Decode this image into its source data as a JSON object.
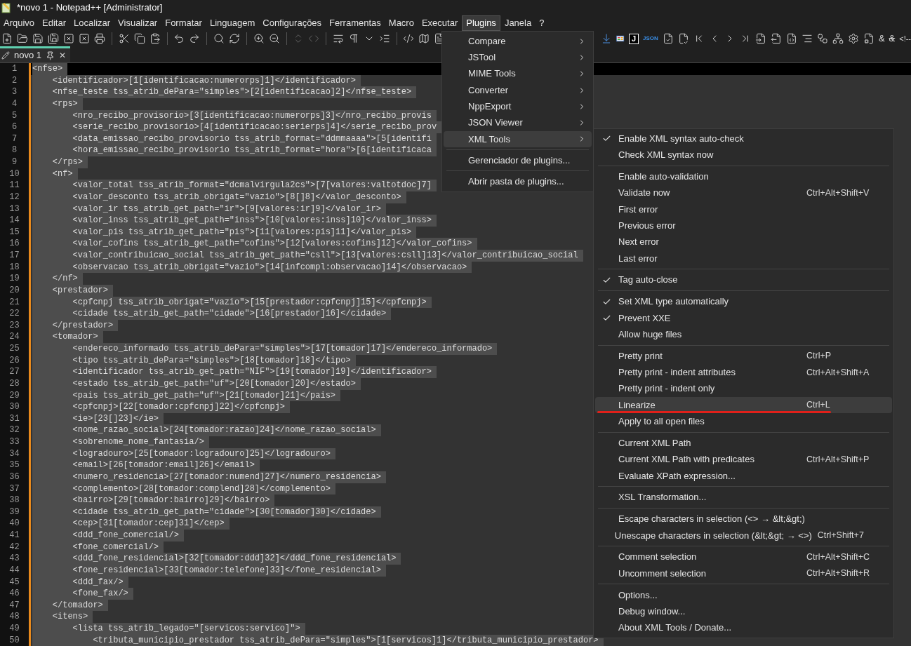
{
  "window": {
    "title": "*novo 1 - Notepad++ [Administrator]"
  },
  "menu_bar": [
    {
      "label": "Arquivo",
      "selected": false
    },
    {
      "label": "Editar",
      "selected": false
    },
    {
      "label": "Localizar",
      "selected": false
    },
    {
      "label": "Visualizar",
      "selected": false
    },
    {
      "label": "Formatar",
      "selected": false
    },
    {
      "label": "Linguagem",
      "selected": false
    },
    {
      "label": "Configurações",
      "selected": false
    },
    {
      "label": "Ferramentas",
      "selected": false
    },
    {
      "label": "Macro",
      "selected": false
    },
    {
      "label": "Executar",
      "selected": false
    },
    {
      "label": "Plugins",
      "selected": true
    },
    {
      "label": "Janela",
      "selected": false
    },
    {
      "label": "?",
      "selected": false
    }
  ],
  "toolbar": {
    "badges": [
      "J",
      "JSON"
    ],
    "glyphs": [
      "&",
      "&",
      "<!--"
    ]
  },
  "tabs": [
    {
      "label": "novo 1",
      "selected": true,
      "close": "✕"
    }
  ],
  "editor": {
    "lines": [
      {
        "n": "1",
        "text": "<nfse>",
        "selected": true,
        "current": true
      },
      {
        "n": "2",
        "text": "    <identificador>[1[identificacao:numerorps]1]</identificador>",
        "selected": true,
        "current": false
      },
      {
        "n": "3",
        "text": "    <nfse_teste tss_atrib_dePara=\"simples\">[2[identificacao]2]</nfse_teste>",
        "selected": true,
        "current": false
      },
      {
        "n": "4",
        "text": "    <rps>",
        "selected": true,
        "current": false
      },
      {
        "n": "5",
        "text": "        <nro_recibo_provisorio>[3[identificacao:numerorps]3]</nro_recibo_provis",
        "selected": true,
        "current": false
      },
      {
        "n": "6",
        "text": "        <serie_recibo_provisorio>[4[identificacao:serierps]4]</serie_recibo_prov",
        "selected": true,
        "current": false
      },
      {
        "n": "7",
        "text": "        <data_emissao_recibo_provisorio tss_atrib_format=\"ddmmaaaa\">[5[identifi",
        "selected": true,
        "current": false
      },
      {
        "n": "8",
        "text": "        <hora_emissao_recibo_provisorio tss_atrib_format=\"hora\">[6[identificaca",
        "selected": true,
        "current": false
      },
      {
        "n": "9",
        "text": "    </rps>",
        "selected": true,
        "current": false
      },
      {
        "n": "10",
        "text": "    <nf>",
        "selected": true,
        "current": false
      },
      {
        "n": "11",
        "text": "        <valor_total tss_atrib_format=\"dcmalvirgula2cs\">[7[valores:valtotdoc]7]",
        "selected": true,
        "current": false
      },
      {
        "n": "12",
        "text": "        <valor_desconto tss_atrib_obrigat=\"vazio\">[8[]8]</valor_desconto>",
        "selected": true,
        "current": false
      },
      {
        "n": "13",
        "text": "        <valor_ir tss_atrib_get_path=\"ir\">[9[valores:ir]9]</valor_ir>",
        "selected": true,
        "current": false
      },
      {
        "n": "14",
        "text": "        <valor_inss tss_atrib_get_path=\"inss\">[10[valores:inss]10]</valor_inss>",
        "selected": true,
        "current": false
      },
      {
        "n": "15",
        "text": "        <valor_pis tss_atrib_get_path=\"pis\">[11[valores:pis]11]</valor_pis>",
        "selected": true,
        "current": false
      },
      {
        "n": "16",
        "text": "        <valor_cofins tss_atrib_get_path=\"cofins\">[12[valores:cofins]12]</valor_cofins>",
        "selected": true,
        "current": false
      },
      {
        "n": "17",
        "text": "        <valor_contribuicao_social tss_atrib_get_path=\"csll\">[13[valores:csll]13]</valor_contribuicao_social",
        "selected": true,
        "current": false
      },
      {
        "n": "18",
        "text": "        <observacao tss_atrib_obrigat=\"vazio\">[14[infcompl:observacao]14]</observacao>",
        "selected": true,
        "current": false
      },
      {
        "n": "19",
        "text": "    </nf>",
        "selected": true,
        "current": false
      },
      {
        "n": "20",
        "text": "    <prestador>",
        "selected": true,
        "current": false
      },
      {
        "n": "21",
        "text": "        <cpfcnpj tss_atrib_obrigat=\"vazio\">[15[prestador:cpfcnpj]15]</cpfcnpj>",
        "selected": true,
        "current": false
      },
      {
        "n": "22",
        "text": "        <cidade tss_atrib_get_path=\"cidade\">[16[prestador]16]</cidade>",
        "selected": true,
        "current": false
      },
      {
        "n": "23",
        "text": "    </prestador>",
        "selected": true,
        "current": false
      },
      {
        "n": "24",
        "text": "    <tomador>",
        "selected": true,
        "current": false
      },
      {
        "n": "25",
        "text": "        <endereco_informado tss_atrib_dePara=\"simples\">[17[tomador]17]</endereco_informado>",
        "selected": true,
        "current": false
      },
      {
        "n": "26",
        "text": "        <tipo tss_atrib_dePara=\"simples\">[18[tomador]18]</tipo>",
        "selected": true,
        "current": false
      },
      {
        "n": "27",
        "text": "        <identificador tss_atrib_get_path=\"NIF\">[19[tomador]19]</identificador>",
        "selected": true,
        "current": false
      },
      {
        "n": "28",
        "text": "        <estado tss_atrib_get_path=\"uf\">[20[tomador]20]</estado>",
        "selected": true,
        "current": false
      },
      {
        "n": "29",
        "text": "        <pais tss_atrib_get_path=\"uf\">[21[tomador]21]</pais>",
        "selected": true,
        "current": false
      },
      {
        "n": "30",
        "text": "        <cpfcnpj>[22[tomador:cpfcnpj]22]</cpfcnpj>",
        "selected": true,
        "current": false
      },
      {
        "n": "31",
        "text": "        <ie>[23[]23]</ie>",
        "selected": true,
        "current": false
      },
      {
        "n": "32",
        "text": "        <nome_razao_social>[24[tomador:razao]24]</nome_razao_social>",
        "selected": true,
        "current": false
      },
      {
        "n": "33",
        "text": "        <sobrenome_nome_fantasia/>",
        "selected": true,
        "current": false
      },
      {
        "n": "34",
        "text": "        <logradouro>[25[tomador:logradouro]25]</logradouro>",
        "selected": true,
        "current": false
      },
      {
        "n": "35",
        "text": "        <email>[26[tomador:email]26]</email>",
        "selected": true,
        "current": false
      },
      {
        "n": "36",
        "text": "        <numero_residencia>[27[tomador:numend]27]</numero_residencia>",
        "selected": true,
        "current": false
      },
      {
        "n": "37",
        "text": "        <complemento>[28[tomador:complend]28]</complemento>",
        "selected": true,
        "current": false
      },
      {
        "n": "38",
        "text": "        <bairro>[29[tomador:bairro]29]</bairro>",
        "selected": true,
        "current": false
      },
      {
        "n": "39",
        "text": "        <cidade tss_atrib_get_path=\"cidade\">[30[tomador]30]</cidade>",
        "selected": true,
        "current": false
      },
      {
        "n": "40",
        "text": "        <cep>[31[tomador:cep]31]</cep>",
        "selected": true,
        "current": false
      },
      {
        "n": "41",
        "text": "        <ddd_fone_comercial/>",
        "selected": true,
        "current": false
      },
      {
        "n": "42",
        "text": "        <fone_comercial/>",
        "selected": true,
        "current": false
      },
      {
        "n": "43",
        "text": "        <ddd_fone_residencial>[32[tomador:ddd]32]</ddd_fone_residencial>",
        "selected": true,
        "current": false
      },
      {
        "n": "44",
        "text": "        <fone_residencial>[33[tomador:telefone]33]</fone_residencial>",
        "selected": true,
        "current": false
      },
      {
        "n": "45",
        "text": "        <ddd_fax/>",
        "selected": true,
        "current": false
      },
      {
        "n": "46",
        "text": "        <fone_fax/>",
        "selected": true,
        "current": false
      },
      {
        "n": "47",
        "text": "    </tomador>",
        "selected": true,
        "current": false
      },
      {
        "n": "48",
        "text": "    <itens>",
        "selected": true,
        "current": false
      },
      {
        "n": "49",
        "text": "        <lista tss_atrib_legado=\"[servicos:servico]\">",
        "selected": true,
        "current": false
      },
      {
        "n": "50",
        "text": "            <tributa_municipio_prestador tss_atrib_dePara=\"simples\">[1[servicos]1]</tributa_municipio_prestador>",
        "selected": true,
        "current": false
      }
    ]
  },
  "plugins_menu": [
    {
      "kind": "submenu",
      "label": "Compare",
      "selected": false
    },
    {
      "kind": "submenu",
      "label": "JSTool",
      "selected": false
    },
    {
      "kind": "submenu",
      "label": "MIME Tools",
      "selected": false
    },
    {
      "kind": "submenu",
      "label": "Converter",
      "selected": false
    },
    {
      "kind": "submenu",
      "label": "NppExport",
      "selected": false
    },
    {
      "kind": "submenu",
      "label": "JSON Viewer",
      "selected": false
    },
    {
      "kind": "submenu",
      "label": "XML Tools",
      "selected": true
    },
    {
      "kind": "separator"
    },
    {
      "kind": "action",
      "label": "Gerenciador de plugins...",
      "selected": false
    },
    {
      "kind": "separator"
    },
    {
      "kind": "action",
      "label": "Abrir pasta de plugins...",
      "selected": false
    }
  ],
  "xml_tools_menu": [
    {
      "kind": "item",
      "label": "Enable XML syntax auto-check",
      "checked": true,
      "selected": false
    },
    {
      "kind": "item",
      "label": "Check XML syntax now",
      "checked": false,
      "selected": false
    },
    {
      "kind": "separator"
    },
    {
      "kind": "item",
      "label": "Enable auto-validation",
      "checked": false,
      "selected": false
    },
    {
      "kind": "item",
      "label": "Validate now",
      "shortcut": "Ctrl+Alt+Shift+V",
      "checked": false,
      "selected": false
    },
    {
      "kind": "item",
      "label": "First error",
      "checked": false,
      "selected": false
    },
    {
      "kind": "item",
      "label": "Previous error",
      "checked": false,
      "selected": false
    },
    {
      "kind": "item",
      "label": "Next error",
      "checked": false,
      "selected": false
    },
    {
      "kind": "item",
      "label": "Last error",
      "checked": false,
      "selected": false
    },
    {
      "kind": "separator"
    },
    {
      "kind": "item",
      "label": "Tag auto-close",
      "checked": true,
      "selected": false
    },
    {
      "kind": "separator"
    },
    {
      "kind": "item",
      "label": "Set XML type automatically",
      "checked": true,
      "selected": false
    },
    {
      "kind": "item",
      "label": "Prevent XXE",
      "checked": true,
      "selected": false
    },
    {
      "kind": "item",
      "label": "Allow huge files",
      "checked": false,
      "selected": false
    },
    {
      "kind": "separator"
    },
    {
      "kind": "item",
      "label": "Pretty print",
      "shortcut": "Ctrl+P",
      "checked": false,
      "selected": false
    },
    {
      "kind": "item",
      "label": "Pretty print - indent attributes",
      "shortcut": "Ctrl+Alt+Shift+A",
      "checked": false,
      "selected": false
    },
    {
      "kind": "item",
      "label": "Pretty print - indent only",
      "checked": false,
      "selected": false
    },
    {
      "kind": "item",
      "label": "Linearize",
      "shortcut": "Ctrl+L",
      "checked": false,
      "selected": true
    },
    {
      "kind": "item",
      "label": "Apply to all open files",
      "checked": false,
      "selected": false
    },
    {
      "kind": "separator"
    },
    {
      "kind": "item",
      "label": "Current XML Path",
      "checked": false,
      "selected": false
    },
    {
      "kind": "item",
      "label": "Current XML Path with predicates",
      "shortcut": "Ctrl+Alt+Shift+P",
      "checked": false,
      "selected": false
    },
    {
      "kind": "item",
      "label": "Evaluate XPath expression...",
      "checked": false,
      "selected": false
    },
    {
      "kind": "separator"
    },
    {
      "kind": "item",
      "label": "XSL Transformation...",
      "checked": false,
      "selected": false
    },
    {
      "kind": "separator"
    },
    {
      "kind": "item",
      "label": "Escape characters in selection (<> → &lt;&gt;)",
      "checked": false,
      "selected": false
    },
    {
      "kind": "item",
      "label": "Unescape characters in selection (&lt;&gt; → <>)",
      "shortcut": "Ctrl+Shift+7",
      "checked": false,
      "selected": false
    },
    {
      "kind": "separator"
    },
    {
      "kind": "item",
      "label": "Comment selection",
      "shortcut": "Ctrl+Alt+Shift+C",
      "checked": false,
      "selected": false
    },
    {
      "kind": "item",
      "label": "Uncomment selection",
      "shortcut": "Ctrl+Alt+Shift+R",
      "checked": false,
      "selected": false
    },
    {
      "kind": "separator"
    },
    {
      "kind": "item",
      "label": "Options...",
      "checked": false,
      "selected": false
    },
    {
      "kind": "item",
      "label": "Debug window...",
      "checked": false,
      "selected": false
    },
    {
      "kind": "item",
      "label": "About XML Tools / Donate...",
      "checked": false,
      "selected": false
    }
  ]
}
